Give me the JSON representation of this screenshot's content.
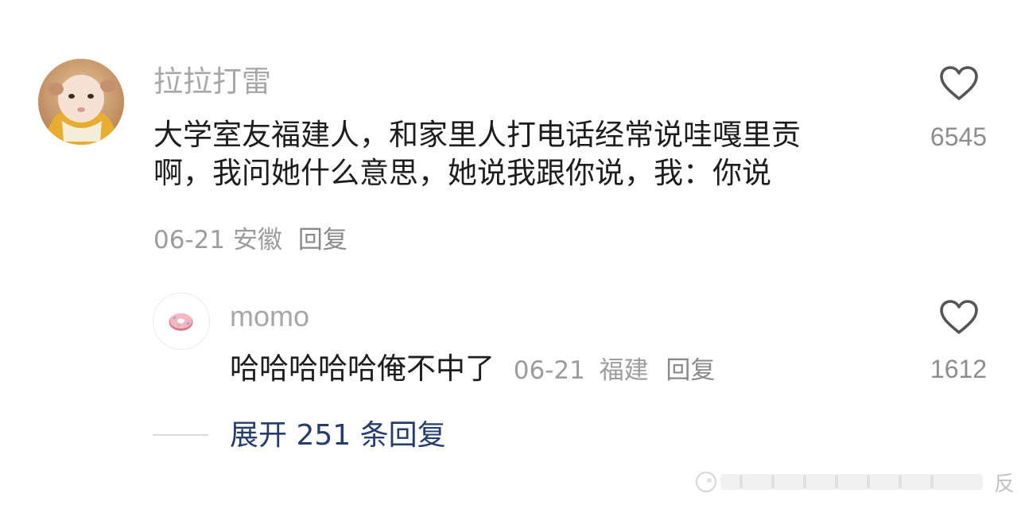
{
  "comment": {
    "username": "拉拉打雷",
    "text_lines": [
      "大学室友福建人，和家里人打电话经常说哇嘎里贡",
      "啊，我问她什么意思，她说我跟你说，我：你说"
    ],
    "date": "06-21",
    "location": "安徽",
    "reply_label": "回复",
    "like_count": "6545",
    "avatar_icon": "baby-photo-avatar",
    "like_icon": "heart-outline-icon"
  },
  "reply": {
    "username": "momo",
    "text": "哈哈哈哈哈俺不中了",
    "date": "06-21",
    "location": "福建",
    "reply_label": "回复",
    "like_count": "1612",
    "avatar_icon": "donut-avatar",
    "like_icon": "heart-outline-icon"
  },
  "expand": {
    "label": "展开 251 条回复"
  },
  "watermark": {
    "text": "反"
  },
  "colors": {
    "username": "#a7a7a7",
    "body_text": "#1d1d1d",
    "meta_text": "#9c9c9c",
    "expand_link": "#263c6a",
    "like_icon": "#555555"
  }
}
